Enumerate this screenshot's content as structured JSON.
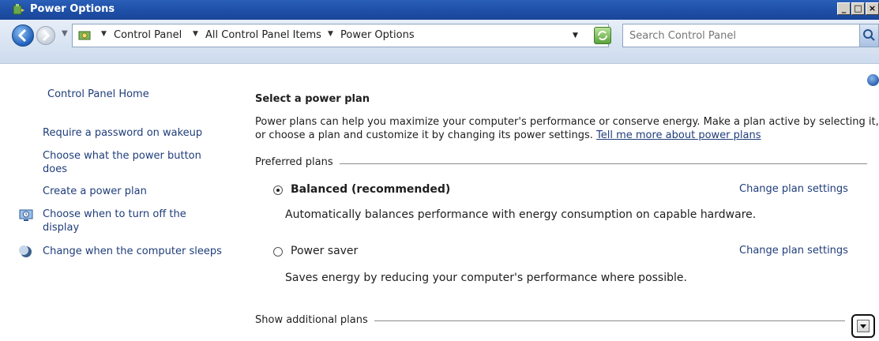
{
  "window": {
    "title": "Power Options",
    "controls": [
      "minimize",
      "maximize",
      "close"
    ]
  },
  "address_bar": {
    "icon": "control-panel-icon",
    "breadcrumbs": [
      "Control Panel",
      "All Control Panel Items",
      "Power Options"
    ],
    "search_placeholder": "Search Control Panel"
  },
  "sidebar": {
    "home_label": "Control Panel Home",
    "items": [
      {
        "label": "Require a password on wakeup"
      },
      {
        "label": "Choose what the power button does"
      },
      {
        "label": "Create a power plan"
      },
      {
        "label": "Choose when to turn off the display",
        "icon": "display-icon"
      },
      {
        "label": "Change when the computer sleeps",
        "icon": "moon-icon"
      }
    ]
  },
  "main": {
    "heading": "Select a power plan",
    "intro": "Power plans can help you maximize your computer's performance or conserve energy. Make a plan active by selecting it, or choose a plan and customize it by changing its power settings.",
    "intro_link": "Tell me more about power plans",
    "preferred_label": "Preferred plans",
    "plans": [
      {
        "name": "Balanced (recommended)",
        "selected": true,
        "description": "Automatically balances performance with energy consumption on capable hardware.",
        "change_label": "Change plan settings"
      },
      {
        "name": "Power saver",
        "selected": false,
        "description": "Saves energy by reducing your computer's performance where possible.",
        "change_label": "Change plan settings"
      }
    ],
    "additional_label": "Show additional plans"
  },
  "colors": {
    "title_bar": "#1e4fa6",
    "link": "#1f3d7a",
    "address_bar": "#dce6f4"
  }
}
